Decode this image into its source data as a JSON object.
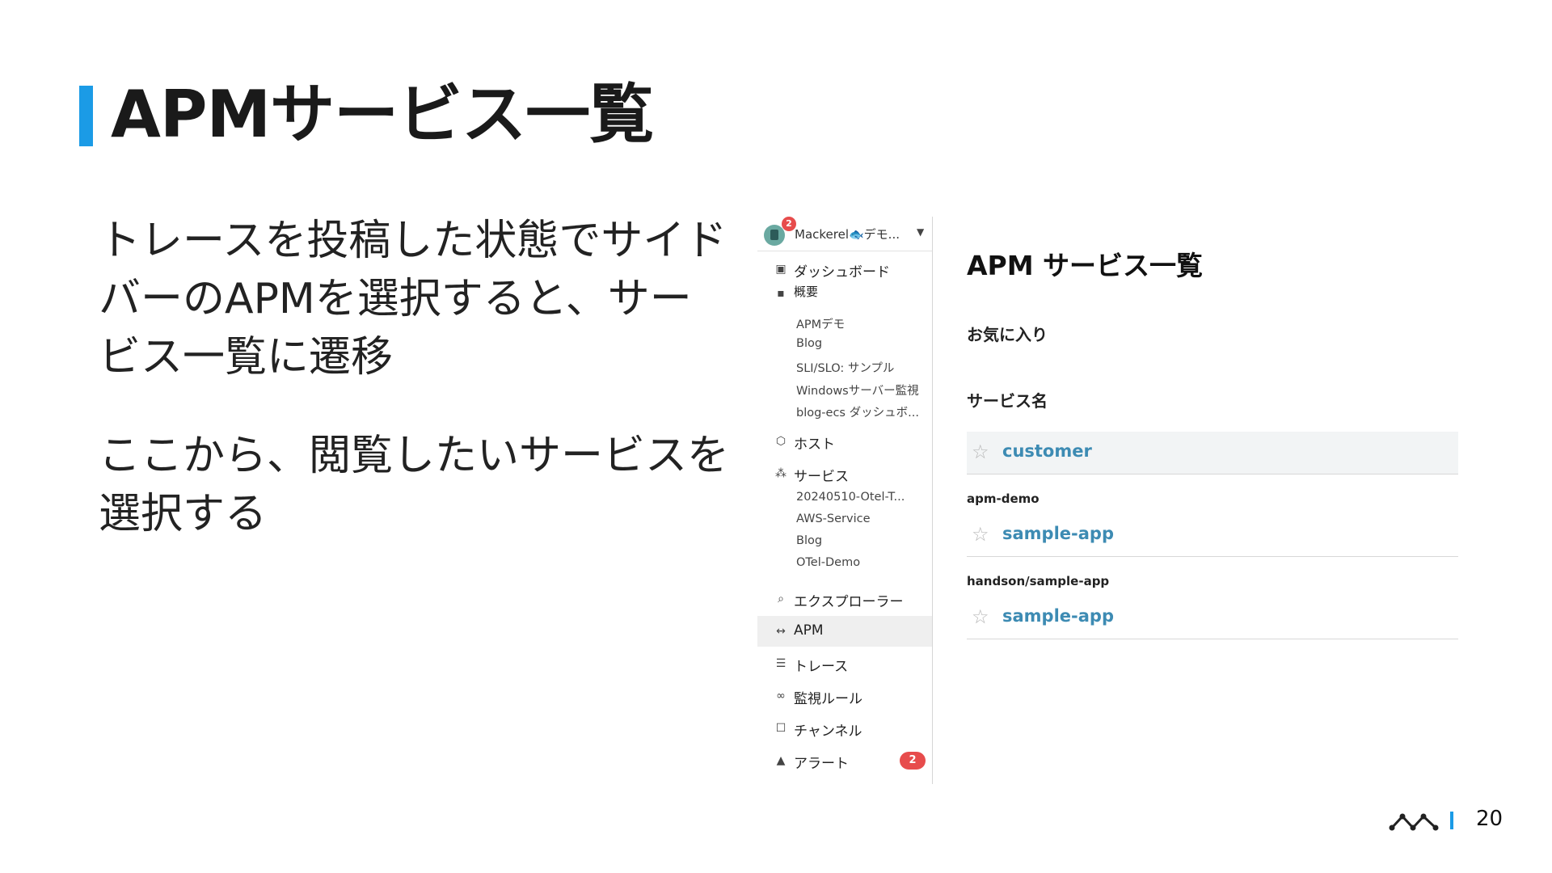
{
  "slide": {
    "title": "APMサービス一覧",
    "paragraph1": "トレースを投稿した状態でサイドバーのAPMを選択すると、サービス一覧に遷移",
    "paragraph2": "ここから、閲覧したいサービスを選択する",
    "page_number": "20",
    "accent_color": "#1b9be6"
  },
  "sidebar": {
    "org_name": "Mackerel🐟デモ...",
    "org_badge": "2",
    "items": [
      {
        "label": "ダッシュボード",
        "icon": "dashboard-icon"
      },
      {
        "label": "概要",
        "icon": "grid-icon"
      },
      {
        "label": "ホスト",
        "icon": "cube-icon"
      },
      {
        "label": "サービス",
        "icon": "services-icon"
      },
      {
        "label": "エクスプローラー",
        "icon": "explorer-icon"
      },
      {
        "label": "APM",
        "icon": "apm-icon"
      },
      {
        "label": "トレース",
        "icon": "trace-icon"
      },
      {
        "label": "監視ルール",
        "icon": "binoculars-icon"
      },
      {
        "label": "チャンネル",
        "icon": "channel-icon"
      },
      {
        "label": "アラート",
        "icon": "bell-icon"
      }
    ],
    "dashboards": [
      "APMデモ",
      "Blog",
      "SLI/SLO: サンプル",
      "Windowsサーバー監視",
      "blog-ecs ダッシュボ..."
    ],
    "services": [
      "20240510-Otel-T...",
      "AWS-Service",
      "Blog",
      "OTel-Demo"
    ],
    "alert_count": "2",
    "active_item": "APM"
  },
  "main": {
    "title": "APM サービス一覧",
    "favorites_label": "お気に入り",
    "service_name_label": "サービス名",
    "rows": [
      {
        "group": "",
        "name": "customer"
      },
      {
        "group": "apm-demo",
        "name": "sample-app"
      },
      {
        "group": "handson/sample-app",
        "name": "sample-app"
      }
    ],
    "link_color": "#3d8bb3"
  }
}
